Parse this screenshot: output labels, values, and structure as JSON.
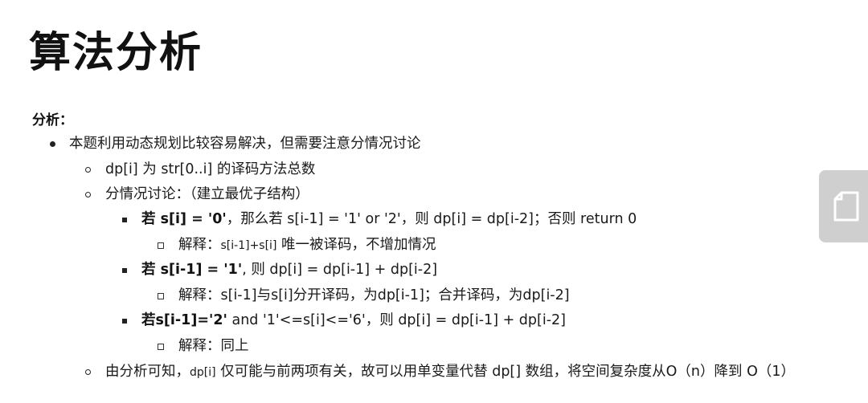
{
  "title": "算法分析",
  "section_label": "分析：",
  "lines": {
    "l1": "本题利用动态规划比较容易解决，但需要注意分情况讨论",
    "l2": "dp[i] 为 str[0..i] 的译码方法总数",
    "l3": "分情况讨论：（建立最优子结构）",
    "l4": {
      "pre": "若 ",
      "bold": "s[i] = '0'",
      "rest": "，那么若 s[i-1] = '1' or '2'，则 dp[i] = dp[i-2]；否则 return 0"
    },
    "l5": {
      "pre": "解释：",
      "small": "s[i-1]+s[i]",
      "rest": " 唯一被译码，不增加情况"
    },
    "l6": {
      "pre": "若 ",
      "bold": "s[i-1] = '1'",
      "rest": ", 则 dp[i] = dp[i-1] + dp[i-2]"
    },
    "l7": "解释：s[i-1]与s[i]分开译码，为dp[i-1]；合并译码，为dp[i-2]",
    "l8": {
      "bold": "若s[i-1]='2'",
      "rest": " and '1'<=s[i]<='6'，则 dp[i] = dp[i-1] + dp[i-2]"
    },
    "l9": "解释：同上",
    "l10": {
      "pre": "由分析可知，",
      "small": "dp[i]",
      "rest": " 仅可能与前两项有关，故可以用单变量代替 dp[] 数组，将空间复杂度从O（n）降到 O（1）"
    }
  },
  "icons": {
    "side_tab": "document-icon"
  }
}
